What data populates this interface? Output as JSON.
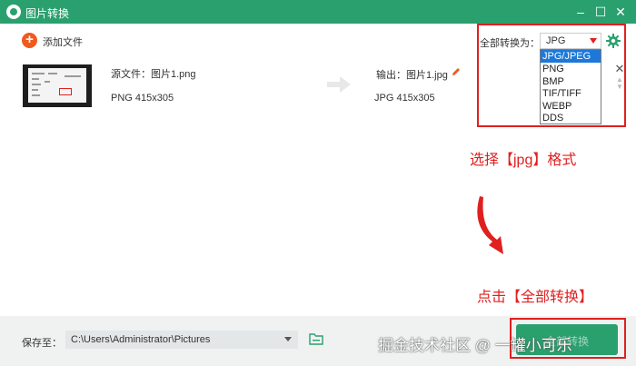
{
  "window": {
    "title": "图片转换"
  },
  "toolbar": {
    "add_file_label": "添加文件"
  },
  "file": {
    "source_name": "源文件：图片1.png",
    "source_meta": "PNG  415x305",
    "output_name": "输出：图片1.jpg",
    "output_meta": "JPG  415x305"
  },
  "format": {
    "label": "全部转换为：",
    "selected": "JPG",
    "options": [
      "JPG/JPEG",
      "PNG",
      "BMP",
      "TIF/TIFF",
      "WEBP",
      "DDS"
    ]
  },
  "annotations": {
    "step1": "选择【jpg】格式",
    "step2": "点击【全部转换】"
  },
  "bottom": {
    "save_label": "保存至：",
    "save_path": "C:\\Users\\Administrator\\Pictures",
    "convert_label": "全部转换"
  },
  "watermark": "掘金技术社区 @ 一罐小可乐",
  "colors": {
    "brand": "#2aa06e",
    "accent": "#f05a1e",
    "annotation": "#e02020",
    "selection": "#1e78d7"
  }
}
